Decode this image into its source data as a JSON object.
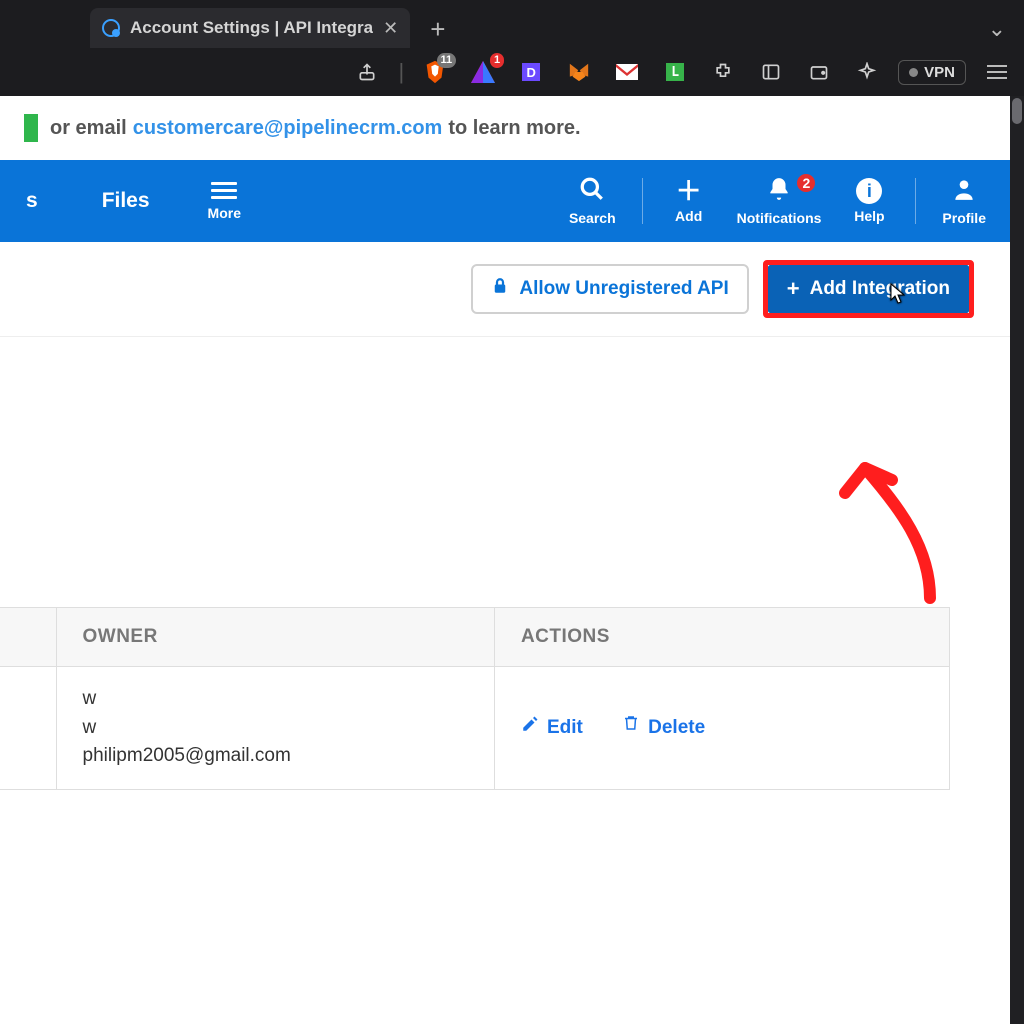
{
  "browser": {
    "tab_title": "Account Settings | API Integra",
    "shield_badge": "11",
    "triangle_badge": "1",
    "vpn_label": "VPN"
  },
  "banner": {
    "prefix": "or email ",
    "email": "customercare@pipelinecrm.com",
    "suffix": " to learn more."
  },
  "nav": {
    "item_partial": "s",
    "files": "Files",
    "more": "More",
    "search": "Search",
    "add": "Add",
    "notifications": "Notifications",
    "notifications_badge": "2",
    "help": "Help",
    "profile": "Profile"
  },
  "actions": {
    "allow_unregistered": "Allow Unregistered API",
    "add_integration": "Add Integration"
  },
  "table": {
    "headers": {
      "owner": "OWNER",
      "actions": "ACTIONS"
    },
    "row": {
      "owner_line1": "w",
      "owner_line2": "w",
      "owner_email": "philipm2005@gmail.com",
      "edit": "Edit",
      "delete": "Delete"
    }
  }
}
